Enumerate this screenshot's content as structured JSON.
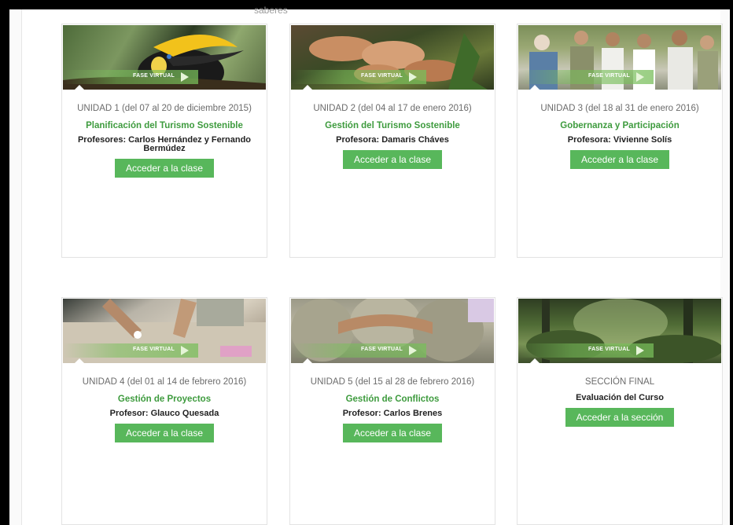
{
  "top_snippet": "saberes",
  "cards": [
    {
      "banner_label": "FASE VIRTUAL",
      "unit": "UNIDAD 1 (del 07 al 20 de diciembre 2015)",
      "course": "Planificación del Turismo Sostenible",
      "teacher": "Profesores: Carlos Hernández y Fernando Bermúdez",
      "button": "Acceder a la clase"
    },
    {
      "banner_label": "FASE VIRTUAL",
      "unit": "UNIDAD 2 (del 04 al 17 de enero 2016)",
      "course": "Gestión del Turismo Sostenible",
      "teacher": "Profesora: Damaris Cháves",
      "button": "Acceder a la clase"
    },
    {
      "banner_label": "FASE VIRTUAL",
      "unit": "UNIDAD 3 (del 18 al 31 de enero 2016)",
      "course": "Gobernanza y Participación",
      "teacher": "Profesora: Vivienne Solís",
      "button": "Acceder a la clase"
    },
    {
      "banner_label": "FASE VIRTUAL",
      "unit": "UNIDAD 4 (del 01 al 14 de febrero 2016)",
      "course": "Gestión de Proyectos",
      "teacher": "Profesor: Glauco Quesada",
      "button": "Acceder a la clase"
    },
    {
      "banner_label": "FASE VIRTUAL",
      "unit": "UNIDAD 5 (del 15 al 28 de febrero 2016)",
      "course": "Gestión de Conflictos",
      "teacher": "Profesor: Carlos Brenes",
      "button": "Acceder a la clase"
    },
    {
      "banner_label": "FASE VIRTUAL",
      "unit": "SECCIÓN FINAL",
      "course": "Evaluación del Curso",
      "button": "Acceder a la sección"
    }
  ]
}
